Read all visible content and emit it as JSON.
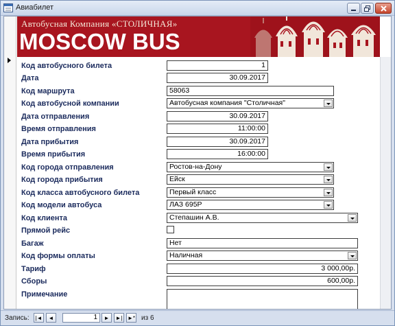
{
  "window": {
    "title": "Авиабилет"
  },
  "banner": {
    "company": "Автобусная Компания «СТОЛИЧНАЯ»",
    "title": "MOSCOW BUS"
  },
  "form": {
    "fields": [
      {
        "label": "Код автобусного билета",
        "value": "1"
      },
      {
        "label": "Дата",
        "value": "30.09.2017"
      },
      {
        "label": "Код маршрута",
        "value": "58063"
      },
      {
        "label": "Код автобусной компании",
        "value": "Автобусная компания \"Столичная\""
      },
      {
        "label": "Дата отправления",
        "value": "30.09.2017"
      },
      {
        "label": "Время отправления",
        "value": "11:00:00"
      },
      {
        "label": "Дата прибытия",
        "value": "30.09.2017"
      },
      {
        "label": "Время прибытия",
        "value": "16:00:00"
      },
      {
        "label": "Код города отправления",
        "value": "Ростов-на-Дону"
      },
      {
        "label": "Код города прибытия",
        "value": "Ейск"
      },
      {
        "label": "Код класса автобусного билета",
        "value": "Первый класс"
      },
      {
        "label": "Код модели автобуса",
        "value": "ЛАЗ 695Р"
      },
      {
        "label": "Код клиента",
        "value": "Степашин А.В."
      },
      {
        "label": "Прямой рейс",
        "value": ""
      },
      {
        "label": "Багаж",
        "value": "Нет"
      },
      {
        "label": "Код формы оплаты",
        "value": "Наличная"
      },
      {
        "label": "Тариф",
        "value": "3 000,00р."
      },
      {
        "label": "Сборы",
        "value": "600,00р."
      },
      {
        "label": "Примечание",
        "value": ""
      }
    ]
  },
  "navbar": {
    "label": "Запись:",
    "first": "|◄",
    "prev": "◄",
    "current": "1",
    "next": "►",
    "last": "►|",
    "new": "►*",
    "of_text": "из 6"
  },
  "colors": {
    "banner_red": "#a8151f",
    "label_blue": "#1a2a5c"
  }
}
